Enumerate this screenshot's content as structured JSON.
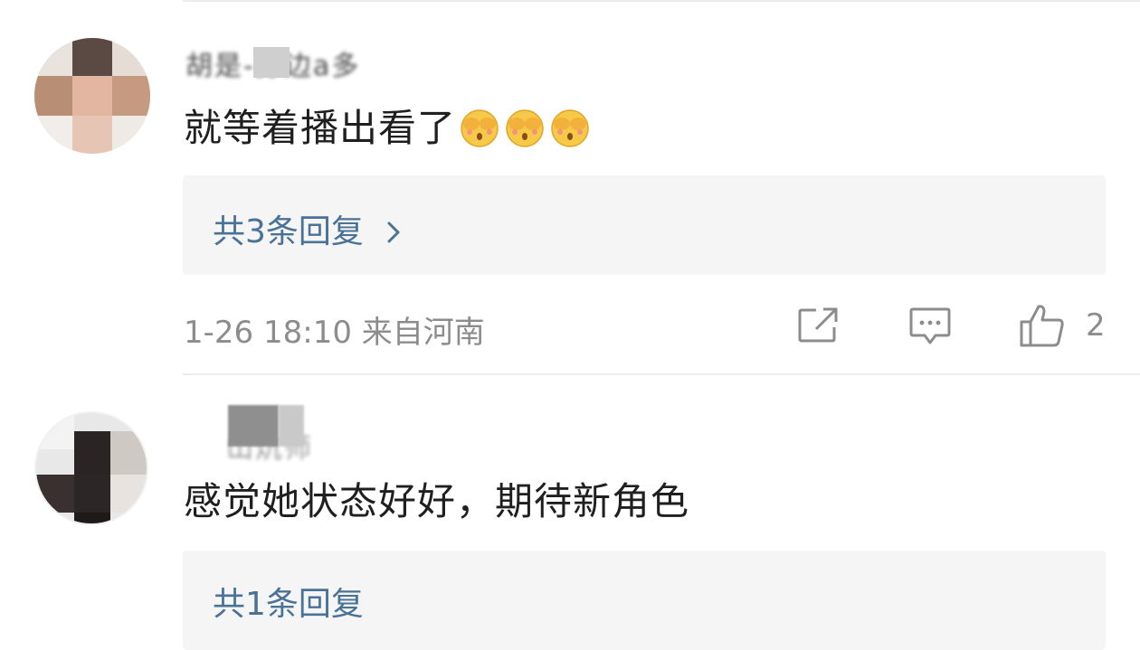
{
  "comments": [
    {
      "username": "胡是-身边a多",
      "text": "就等着播出看了",
      "emoji": [
        "shy-covering-face-emoji",
        "shy-covering-face-emoji",
        "shy-covering-face-emoji"
      ],
      "reply_label": "共3条回复",
      "meta": "1-26 18:10 来自河南",
      "actions": {
        "like_count": "2"
      }
    },
    {
      "username": "山炕师",
      "text": "感觉她状态好好，期待新角色",
      "reply_label": "共1条回复"
    }
  ],
  "icons": {
    "share": "share-icon",
    "comment": "comment-icon",
    "like": "like-icon",
    "chevron": "chevron-right-icon"
  },
  "colors": {
    "reply_link": "#4a7297",
    "meta": "#8c8c8c",
    "reply_bg": "#f5f5f5"
  }
}
